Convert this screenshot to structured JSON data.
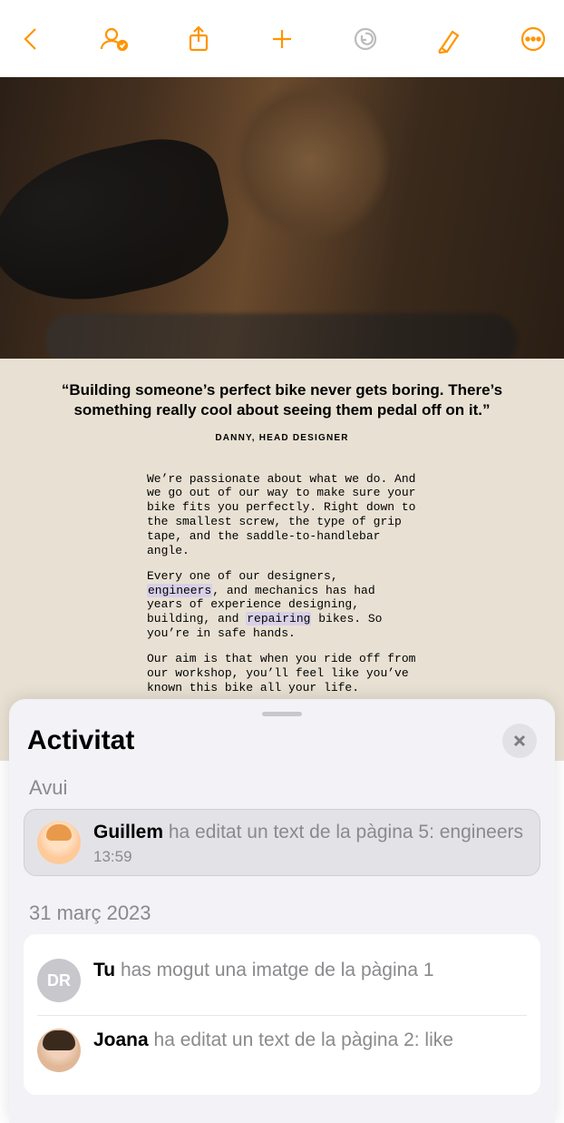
{
  "toolbar": {
    "back": "back-icon",
    "collaborate": "collaborate-icon",
    "share": "share-icon",
    "add": "add-icon",
    "undo": "undo-icon",
    "format": "format-brush-icon",
    "more": "more-icon"
  },
  "document": {
    "quote": "“Building someone’s perfect bike never gets boring. There’s something really cool about seeing them pedal off on it.”",
    "quote_attr": "DANNY, HEAD DESIGNER",
    "para1": "We’re passionate about what we do. And we go out of our way to make sure your bike fits you perfectly. Right down to the smallest screw, the type of grip tape, and the saddle-to-handlebar angle.",
    "para2_a": "Every one of our designers, ",
    "para2_hl1": "engineers",
    "para2_b": ", and mechanics has had years of experience designing, building, and ",
    "para2_hl2": "repairing",
    "para2_c": " bikes. So you’re in safe hands.",
    "para3": "Our aim is that when you ride off from our workshop, you’ll feel like you’ve known this bike all your life."
  },
  "sheet": {
    "title": "Activitat",
    "today_label": "Avui",
    "date2_label": "31 març 2023",
    "items": [
      {
        "user": "Guillem",
        "rest": " ha editat un text de la pàgina 5: engineers",
        "time": "13:59",
        "avatar": "peach"
      },
      {
        "user": "Tu",
        "rest": " has mogut una imatge de la pàgina 1",
        "time": "",
        "avatar_initials": "DR"
      },
      {
        "user": "Joana",
        "rest": " ha editat un text de la pàgina 2: like",
        "time": "",
        "avatar": "joana"
      }
    ]
  }
}
